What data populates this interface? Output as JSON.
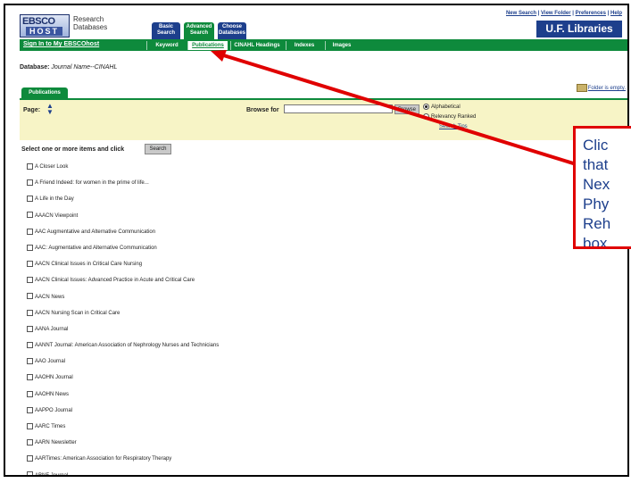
{
  "header": {
    "logo_top": "EBSCO",
    "logo_bottom": "HOST",
    "logo_caption": "Research Databases",
    "tabs": [
      {
        "label": "Basic Search"
      },
      {
        "label": "Advanced Search"
      },
      {
        "label": "Choose Databases"
      }
    ],
    "links": [
      "New Search",
      "View Folder",
      "Preferences",
      "Help"
    ],
    "library": "U.F. Libraries"
  },
  "nav": {
    "sign_in": "Sign In to My EBSCOhost",
    "tabs": [
      "Keyword",
      "Publications",
      "CINAHL Headings",
      "Indexes",
      "Images"
    ],
    "active": "Publications"
  },
  "database": {
    "label": "Database:",
    "value": "Journal Name--CINAHL"
  },
  "publications_tab": "Publications",
  "folder_status": "Folder is empty.",
  "browse": {
    "page_label": "Page:",
    "browse_label": "Browse for",
    "input_value": "",
    "button": "Browse",
    "options": [
      "Alphabetical",
      "Relevancy Ranked"
    ],
    "selected": "Alphabetical",
    "search_tips": "Search Tips"
  },
  "select_label": "Select one or more items and click",
  "search_button": "Search",
  "items": [
    "A Closer Look",
    "A Friend Indeed: for women in the prime of life...",
    "A Life in the Day",
    "AAACN Viewpoint",
    "AAC Augmentative and Alternative Communication",
    "AAC: Augmentative and Alternative Communication",
    "AACN Clinical Issues in Critical Care Nursing",
    "AACN Clinical Issues: Advanced Practice in Acute and Critical Care",
    "AACN News",
    "AACN Nursing Scan in Critical Care",
    "AANA Journal",
    "AANNT Journal: American Association of Nephrology Nurses and Technicians",
    "AAO Journal",
    "AAOHN Journal",
    "AAOHN News",
    "AAPPO Journal",
    "AARC Times",
    "AARN Newsletter",
    "AARTimes: American Association for Respiratory Therapy",
    "ABNF Journal"
  ],
  "callout": {
    "text": "Clic\nthat\nNex\nPhy\nReh\nbox"
  },
  "colors": {
    "ebsco_green": "#0e8a3c",
    "ebsco_blue": "#1d3f8c",
    "panel_yellow": "#f7f4c6",
    "annotation_red": "#e00000"
  }
}
